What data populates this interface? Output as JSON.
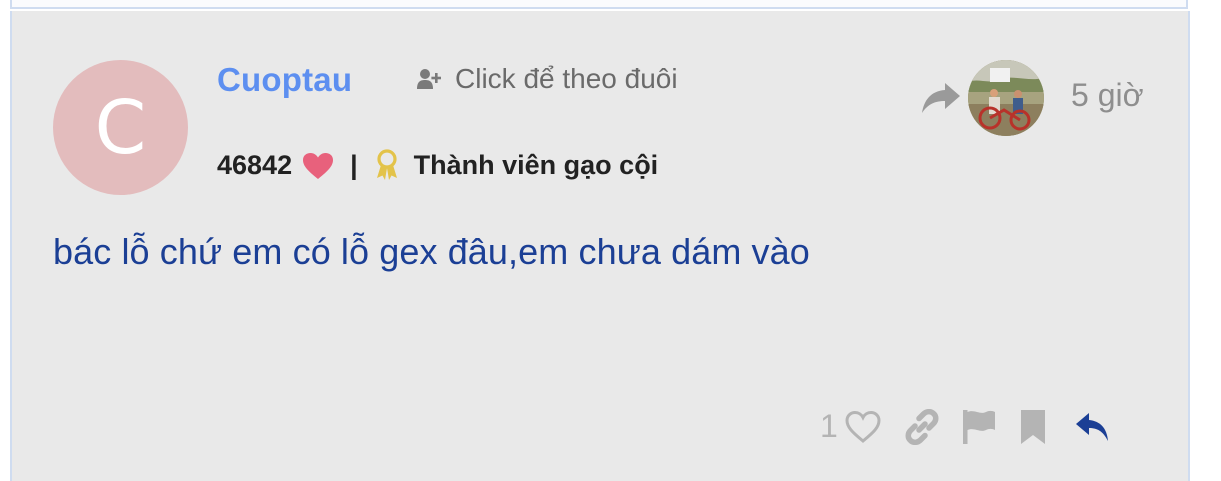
{
  "post": {
    "avatar_letter": "C",
    "username": "Cuoptau",
    "follow_label": "Click để theo đuôi",
    "points": "46842",
    "separator": "|",
    "rank": "Thành viên gạo cội",
    "time": "5 giờ",
    "content": "bác lỗ chứ em có lỗ gex đâu,em chưa dám vào",
    "like_count": "1"
  },
  "colors": {
    "username": "#5d8ff0",
    "content": "#1b3f95",
    "heart": "#e8617c",
    "badge": "#e3c34a",
    "background": "#e9e9e9",
    "reply_icon": "#1b3f95",
    "muted_icon": "#b4b4b4"
  },
  "icons": [
    "add-user-icon",
    "heart-icon",
    "award-badge-icon",
    "share-arrow-icon",
    "like-heart-outline-icon",
    "link-icon",
    "flag-icon",
    "bookmark-icon",
    "reply-icon"
  ]
}
